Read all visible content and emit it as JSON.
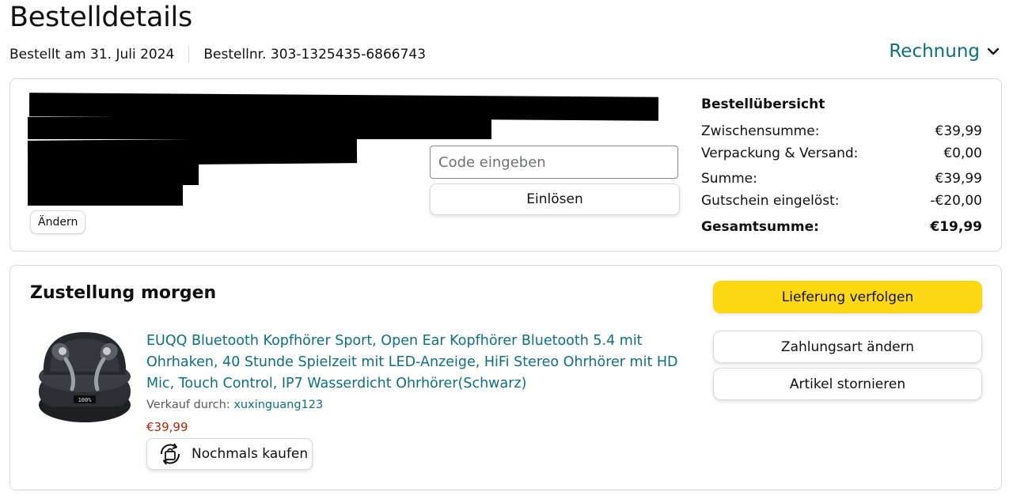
{
  "header": {
    "title": "Bestelldetails",
    "order_date": "Bestellt am 31. Juli 2024",
    "order_number": "Bestellnr. 303-1325435-6866743",
    "invoice_label": "Rechnung"
  },
  "address": {
    "change_label": "Ändern"
  },
  "coupon": {
    "placeholder": "Code eingeben",
    "redeem_label": "Einlösen"
  },
  "summary": {
    "title": "Bestellübersicht",
    "rows": [
      {
        "label": "Zwischensumme:",
        "value": "€39,99"
      },
      {
        "label": "Verpackung & Versand:",
        "value": "€0,00"
      },
      {
        "label": "Summe:",
        "value": "€39,99"
      },
      {
        "label": "Gutschein eingelöst:",
        "value": "-€20,00"
      }
    ],
    "total_label": "Gesamtsumme:",
    "total_value": "€19,99"
  },
  "delivery": {
    "title": "Zustellung morgen",
    "product_title": "EUQQ Bluetooth Kopfhörer Sport, Open Ear Kopfhörer Bluetooth 5.4 mit Ohrhaken, 40 Stunde Spielzeit mit LED-Anzeige, HiFi Stereo Ohrhörer mit HD Mic, Touch Control, IP7 Wasserdicht Ohrhörer(Schwarz)",
    "sold_by_label": "Verkauf durch:",
    "seller": "xuxinguang123",
    "price": "€39,99",
    "buy_again_label": "Nochmals kaufen",
    "case_display": "100%",
    "actions": {
      "track": "Lieferung verfolgen",
      "payment": "Zahlungsart ändern",
      "cancel": "Artikel stornieren"
    }
  },
  "colors": {
    "link": "#0f6f80",
    "primary_button": "#ffd814",
    "price": "#b12704"
  }
}
